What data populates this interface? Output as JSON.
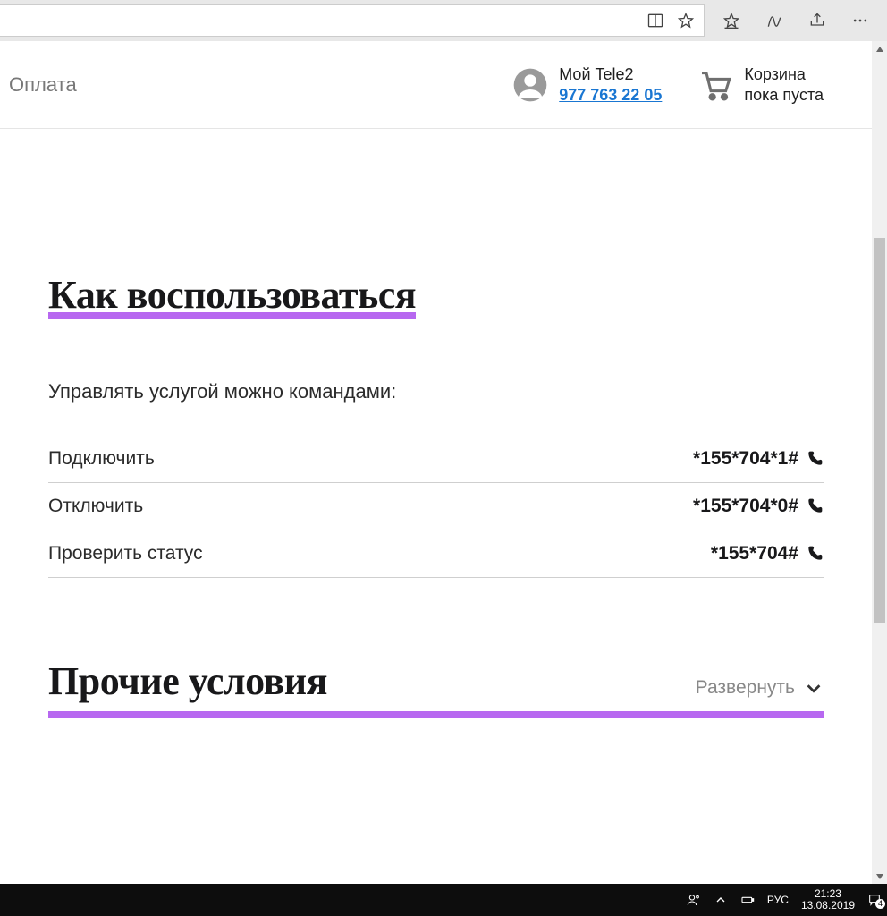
{
  "header": {
    "nav_payment": "Оплата",
    "account_label": "Мой Tele2",
    "account_phone": "977 763 22 05",
    "cart_label": "Корзина",
    "cart_status": "пока пуста"
  },
  "section_howto": {
    "heading": "Как воспользоваться",
    "subtitle": "Управлять услугой можно командами:",
    "rows": [
      {
        "label": "Подключить",
        "code": "*155*704*1#"
      },
      {
        "label": "Отключить",
        "code": "*155*704*0#"
      },
      {
        "label": "Проверить статус",
        "code": "*155*704#"
      }
    ]
  },
  "section_other": {
    "heading": "Прочие условия",
    "expand_label": "Развернуть"
  },
  "taskbar": {
    "lang": "РУС",
    "time": "21:23",
    "date": "13.08.2019",
    "notif_count": "4"
  }
}
